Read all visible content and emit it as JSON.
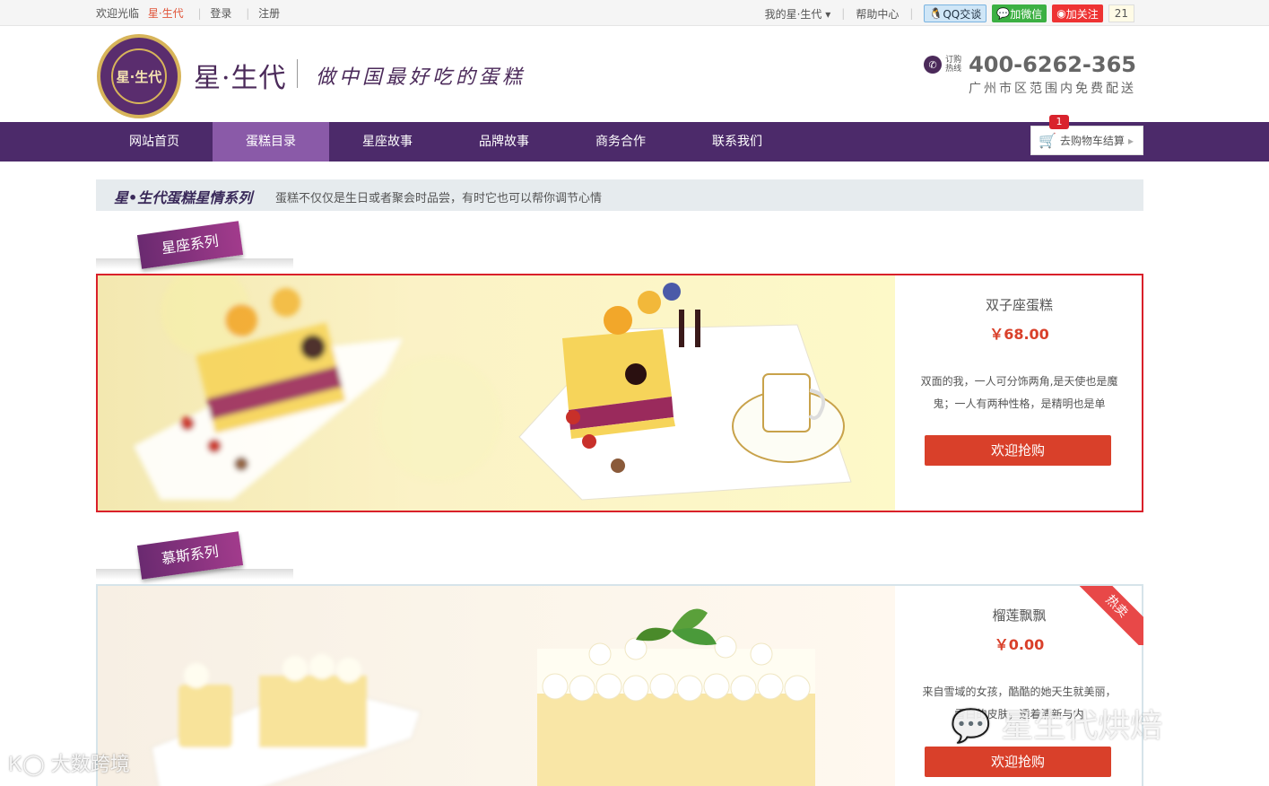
{
  "topbar": {
    "welcome": "欢迎光临",
    "brand_link": "星·生代",
    "login": "登录",
    "register": "注册",
    "my_account": "我的星·生代",
    "help": "帮助中心",
    "qq": "QQ交谈",
    "wechat": "加微信",
    "weibo": "加关注",
    "follow_count": "21"
  },
  "header": {
    "logo_text": "星·生代",
    "brand": "星·生代",
    "slogan": "做中国最好吃的蛋糕",
    "order_label": "订购热线",
    "phone": "400-6262-365",
    "delivery": "广州市区范围内免费配送"
  },
  "nav": {
    "items": [
      "网站首页",
      "蛋糕目录",
      "星座故事",
      "品牌故事",
      "商务合作",
      "联系我们"
    ],
    "active_index": 1,
    "cart_label": "去购物车结算",
    "cart_count": "1"
  },
  "series": {
    "title": "星•生代蛋糕星情系列",
    "subtitle": "蛋糕不仅仅是生日或者聚会时品尝，有时它也可以帮你调节心情"
  },
  "categories": [
    {
      "tag": "星座系列",
      "product": {
        "name": "双子座蛋糕",
        "price": "￥68.00",
        "desc": "双面的我，一人可分饰两角,是天使也是魔鬼；一人有两种性格，是精明也是单",
        "button": "欢迎抢购"
      }
    },
    {
      "tag": "慕斯系列",
      "product": {
        "name": "榴莲飘飘",
        "price": "￥0.00",
        "desc": "来自雪域的女孩，酷酷的她天生就美丽，雪白的皮肤，透着清新与内",
        "button": "欢迎抢购",
        "badge": "热卖"
      }
    }
  ],
  "watermarks": {
    "left": "大数跨境",
    "right": "星生代烘焙"
  },
  "colors": {
    "nav_bg": "#4c2a6a",
    "nav_active": "#8a5aa8",
    "buy_button": "#d9402a",
    "highlight_border": "#d9202a"
  }
}
